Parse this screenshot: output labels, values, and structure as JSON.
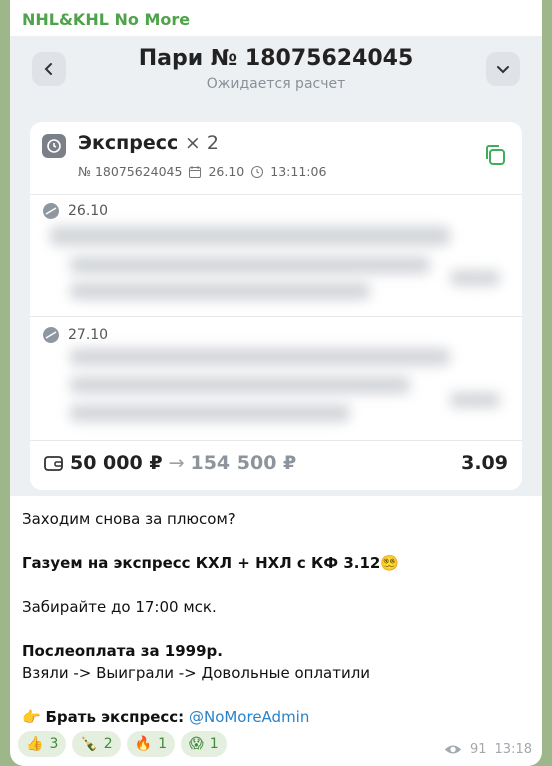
{
  "channel": {
    "name": "NHL&KHL No More"
  },
  "bet": {
    "title": "Пари № 18075624045",
    "status": "Ожидается расчет",
    "type": "Экспресс",
    "multiplier": "× 2",
    "number": "№ 18075624045",
    "date": "26.10",
    "time": "13:11:06",
    "legs": [
      {
        "date": "26.10"
      },
      {
        "date": "27.10"
      }
    ],
    "stake": "50 000 ₽",
    "payout": "154 500 ₽",
    "odds": "3.09"
  },
  "message": {
    "line1": "Заходим снова за плюсом?",
    "line2": "Газуем на экспресс КХЛ + НХЛ с КФ 3.12",
    "line2_emoji": "😵‍💫",
    "line3": "Забирайте до 17:00 мск.",
    "line4": "Послеоплата за 1999р.",
    "line5": "Взяли -> Выиграли -> Довольные оплатили",
    "cta_emoji": "👉",
    "cta_label": "Брать экспресс:",
    "cta_link": "@NoMoreAdmin"
  },
  "reactions": [
    {
      "emoji": "👍",
      "count": "3"
    },
    {
      "emoji": "🍾",
      "count": "2"
    },
    {
      "emoji": "🔥",
      "count": "1"
    },
    {
      "emoji": "😱",
      "count": "1"
    }
  ],
  "footer": {
    "views": "91",
    "time": "13:18"
  },
  "colors": {
    "channel": "#4fa34a",
    "link": "#2a82c8",
    "reaction_bg": "#e4efe0"
  }
}
